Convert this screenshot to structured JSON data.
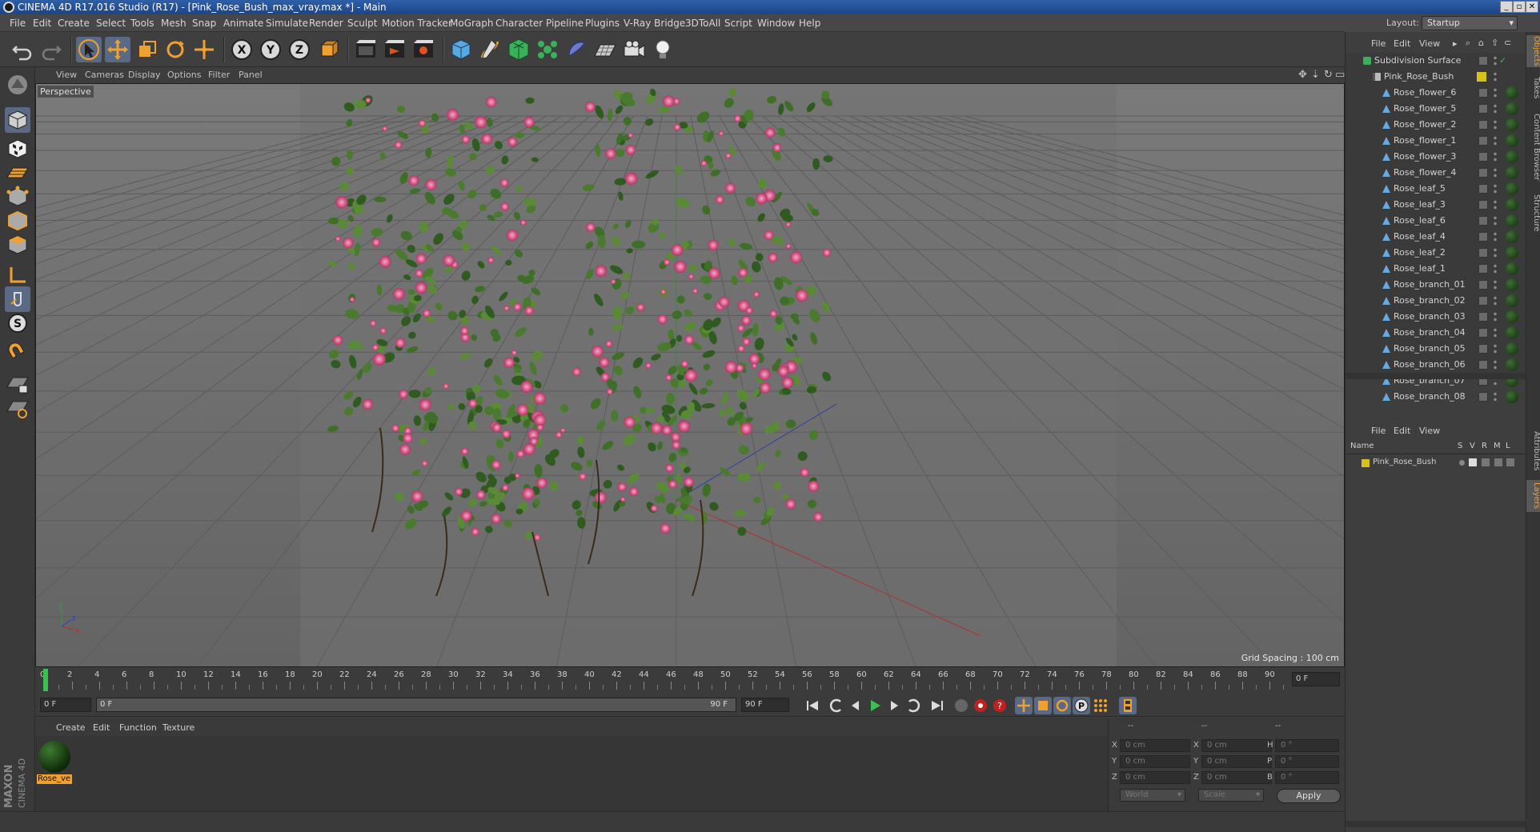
{
  "window": {
    "title": "CINEMA 4D R17.016 Studio (R17) - [Pink_Rose_Bush_max_vray.max *] - Main"
  },
  "menu": [
    "File",
    "Edit",
    "Create",
    "Select",
    "Tools",
    "Mesh",
    "Snap",
    "Animate",
    "Simulate",
    "Render",
    "Sculpt",
    "Motion Tracker",
    "MoGraph",
    "Character",
    "Pipeline",
    "Plugins",
    "V-Ray Bridge",
    "3DToAll",
    "Script",
    "Window",
    "Help"
  ],
  "layout": {
    "label": "Layout:",
    "value": "Startup"
  },
  "viewport": {
    "menu": [
      "View",
      "Cameras",
      "Display",
      "Options",
      "Filter",
      "Panel"
    ],
    "label": "Perspective",
    "grid_spacing": "Grid Spacing : 100 cm"
  },
  "timeline": {
    "ticks": [
      "0",
      "2",
      "4",
      "6",
      "8",
      "10",
      "12",
      "14",
      "16",
      "18",
      "20",
      "22",
      "24",
      "26",
      "28",
      "30",
      "32",
      "34",
      "36",
      "38",
      "40",
      "42",
      "44",
      "46",
      "48",
      "50",
      "52",
      "54",
      "56",
      "58",
      "60",
      "62",
      "64",
      "66",
      "68",
      "70",
      "72",
      "74",
      "76",
      "78",
      "80",
      "82",
      "84",
      "86",
      "88",
      "90"
    ],
    "current_frame": "0 F",
    "start_field": "0 F",
    "range_start": "0 F",
    "range_end": "90 F",
    "end_field": "90 F"
  },
  "material_manager": {
    "menu": [
      "Create",
      "Edit",
      "Function",
      "Texture"
    ],
    "materials": [
      {
        "name": "Rose_ve"
      }
    ]
  },
  "coordinates": {
    "headers": [
      "--",
      "--",
      "--"
    ],
    "rows": [
      {
        "a": "X",
        "a_val": "0 cm",
        "b": "X",
        "b_val": "0 cm",
        "c": "H",
        "c_val": "0 °"
      },
      {
        "a": "Y",
        "a_val": "0 cm",
        "b": "Y",
        "b_val": "0 cm",
        "c": "P",
        "c_val": "0 °"
      },
      {
        "a": "Z",
        "a_val": "0 cm",
        "b": "Z",
        "b_val": "0 cm",
        "c": "B",
        "c_val": "0 °"
      }
    ],
    "world": "World",
    "scale": "Scale",
    "apply": "Apply"
  },
  "object_manager": {
    "menu": [
      "File",
      "Edit",
      "View"
    ],
    "objects": [
      {
        "name": "Subdivision Surface",
        "indent": 0
      },
      {
        "name": "Pink_Rose_Bush",
        "indent": 1
      },
      {
        "name": "Rose_flower_6",
        "indent": 2
      },
      {
        "name": "Rose_flower_5",
        "indent": 2
      },
      {
        "name": "Rose_flower_2",
        "indent": 2
      },
      {
        "name": "Rose_flower_1",
        "indent": 2
      },
      {
        "name": "Rose_flower_3",
        "indent": 2
      },
      {
        "name": "Rose_flower_4",
        "indent": 2
      },
      {
        "name": "Rose_leaf_5",
        "indent": 2
      },
      {
        "name": "Rose_leaf_3",
        "indent": 2
      },
      {
        "name": "Rose_leaf_6",
        "indent": 2
      },
      {
        "name": "Rose_leaf_4",
        "indent": 2
      },
      {
        "name": "Rose_leaf_2",
        "indent": 2
      },
      {
        "name": "Rose_leaf_1",
        "indent": 2
      },
      {
        "name": "Rose_branch_01",
        "indent": 2
      },
      {
        "name": "Rose_branch_02",
        "indent": 2
      },
      {
        "name": "Rose_branch_03",
        "indent": 2
      },
      {
        "name": "Rose_branch_04",
        "indent": 2
      },
      {
        "name": "Rose_branch_05",
        "indent": 2
      },
      {
        "name": "Rose_branch_06",
        "indent": 2
      },
      {
        "name": "Rose_branch_07",
        "indent": 2
      },
      {
        "name": "Rose_branch_08",
        "indent": 2
      }
    ]
  },
  "layer_manager": {
    "menu": [
      "File",
      "Edit",
      "View"
    ],
    "columns": {
      "name": "Name",
      "flags": [
        "S",
        "V",
        "R",
        "M",
        "L"
      ]
    },
    "layers": [
      {
        "name": "Pink_Rose_Bush"
      }
    ]
  },
  "side_tabs": [
    "Objects",
    "Takes",
    "Content Browser",
    "Structure",
    "Attributes",
    "Layers"
  ],
  "branding": [
    "MAXON",
    "CINEMA 4D"
  ],
  "colors": {
    "accent": "#f0a030",
    "flower": "#d65a8a",
    "foliage": "#4a7a2e",
    "layer": "#d8c020"
  }
}
